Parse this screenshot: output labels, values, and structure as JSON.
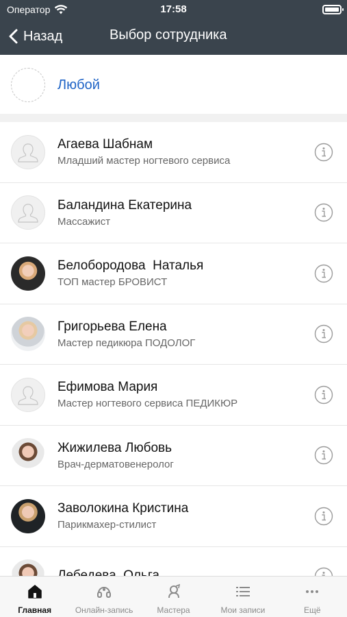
{
  "status_bar": {
    "carrier": "Оператор",
    "time": "17:58"
  },
  "nav": {
    "back_label": "Назад",
    "title": "Выбор сотрудника"
  },
  "any_option": {
    "label": "Любой"
  },
  "employees": [
    {
      "name": "Агаева Шабнам",
      "role": "Младший мастер ногтевого сервиса",
      "avatar": "placeholder"
    },
    {
      "name": "Баландина Екатерина",
      "role": "Массажист",
      "avatar": "placeholder"
    },
    {
      "name": "Белобородова  Наталья",
      "role": "ТОП мастер БРОВИСТ",
      "avatar": "photo"
    },
    {
      "name": "Григорьева Елена",
      "role": "Мастер педикюра ПОДОЛОГ",
      "avatar": "photo"
    },
    {
      "name": "Ефимова Мария",
      "role": "Мастер ногтевого сервиса ПЕДИКЮР",
      "avatar": "placeholder"
    },
    {
      "name": "Жижилева Любовь",
      "role": "Врач-дерматовенеролог",
      "avatar": "photo"
    },
    {
      "name": "Заволокина Кристина",
      "role": "Парикмахер-стилист",
      "avatar": "photo"
    },
    {
      "name": "Лебедева  Ольга",
      "role": "",
      "avatar": "photo"
    }
  ],
  "tabbar": {
    "tabs": [
      {
        "label": "Главная",
        "icon": "home-icon",
        "active": true
      },
      {
        "label": "Онлайн-запись",
        "icon": "headset-icon",
        "active": false
      },
      {
        "label": "Мастера",
        "icon": "master-icon",
        "active": false
      },
      {
        "label": "Мои записи",
        "icon": "list-icon",
        "active": false
      },
      {
        "label": "Ещё",
        "icon": "more-icon",
        "active": false
      }
    ]
  },
  "colors": {
    "header_bg": "#3a444d",
    "accent_link": "#1e63c6",
    "tab_active": "#111111",
    "tab_inactive": "#8a8a8a"
  }
}
